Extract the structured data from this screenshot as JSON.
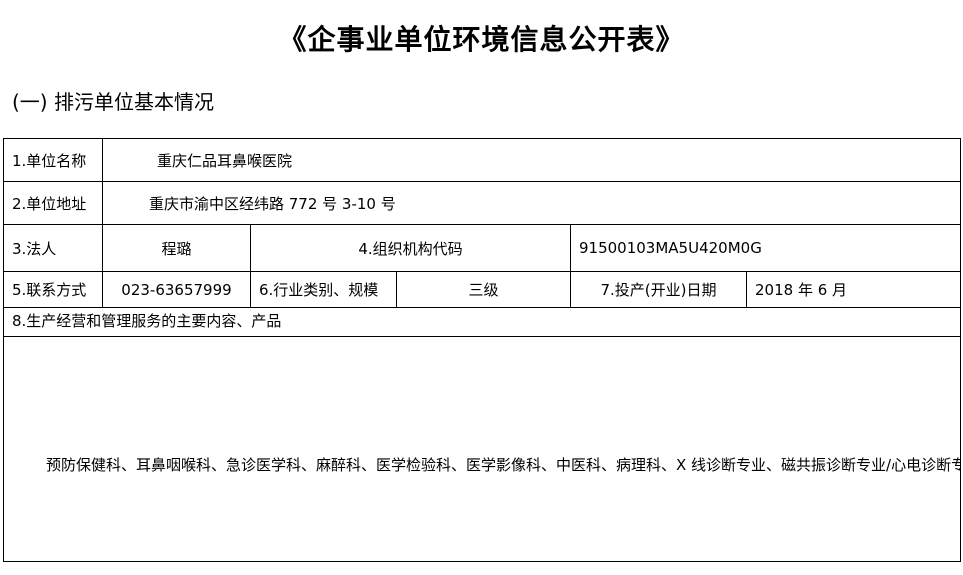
{
  "document": {
    "title": "《企事业单位环境信息公开表》",
    "section": "(一) 排污单位基本情况"
  },
  "table": {
    "unit_name_label": "1.单位名称",
    "unit_name_value": "重庆仁品耳鼻喉医院",
    "address_label": "2.单位地址",
    "address_value": "重庆市渝中区经纬路 772 号 3-10 号",
    "legal_person_label": "3.法人",
    "legal_person_value": "程璐",
    "org_code_label": "4.组织机构代码",
    "org_code_value": "91500103MA5U420M0G",
    "contact_label": "5.联系方式",
    "contact_value": "023-63657999",
    "industry_label": "6.行业类别、规模",
    "industry_value": "三级",
    "open_date_label": "7.投产(开业)日期",
    "open_date_value": "2018 年 6 月",
    "business_label": "8.生产经营和管理服务的主要内容、产品",
    "business_value": "预防保健科、耳鼻咽喉科、急诊医学科、麻醉科、医学检验科、医学影像科、中医科、病理科、X 线诊断专业、磁共振诊断专业/心电诊断专业、超声诊断专业"
  }
}
